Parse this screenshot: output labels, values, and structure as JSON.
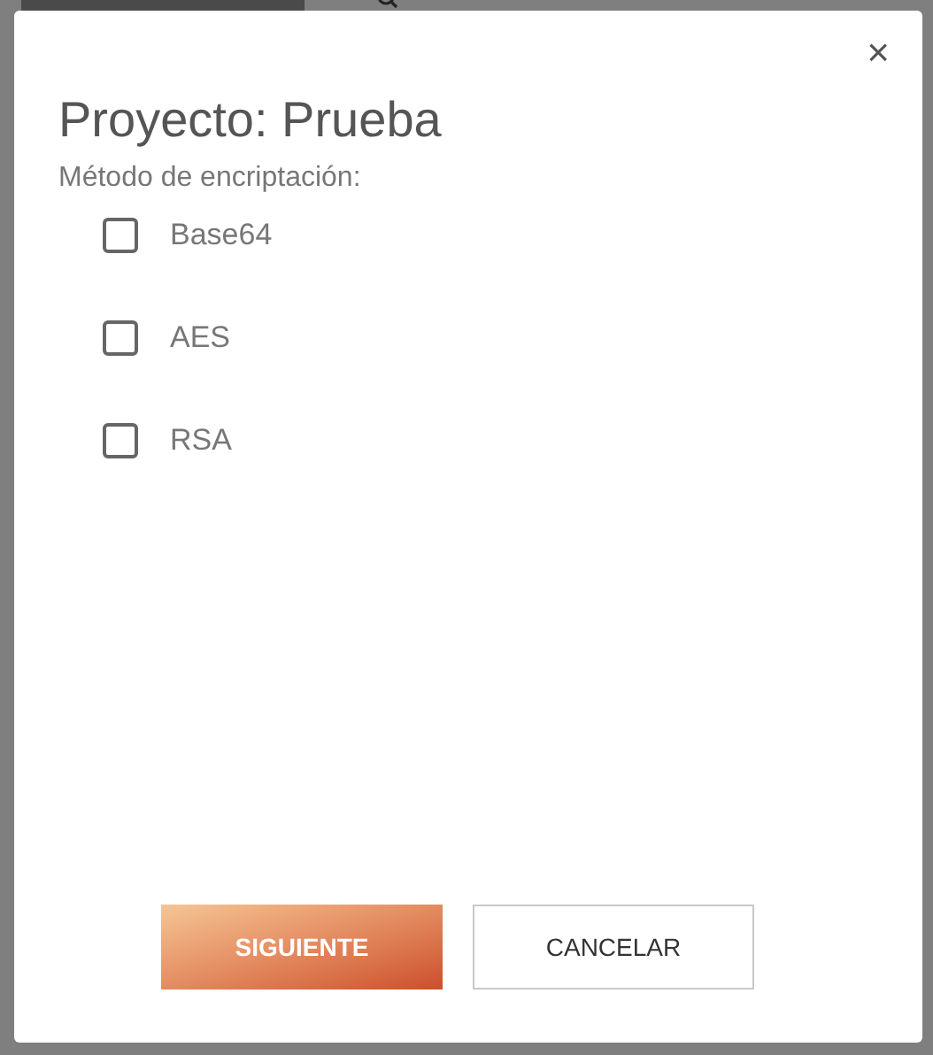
{
  "dialog": {
    "close": "×",
    "title": "Proyecto: Prueba",
    "label": "Método de encriptación:",
    "options": [
      {
        "label": "Base64",
        "checked": false
      },
      {
        "label": "AES",
        "checked": false
      },
      {
        "label": "RSA",
        "checked": false
      }
    ],
    "buttons": [
      {
        "label": "SIGUIENTE",
        "kind": "primary"
      },
      {
        "label": "CANCELAR",
        "kind": "secondary"
      }
    ]
  }
}
